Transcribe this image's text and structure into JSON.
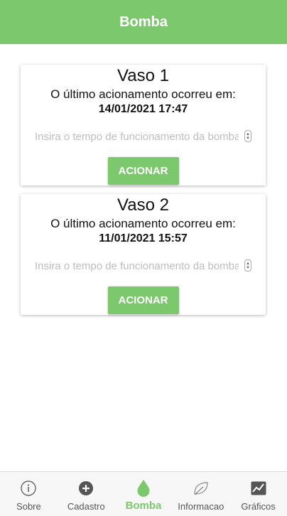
{
  "header": {
    "title": "Bomba"
  },
  "cards": [
    {
      "title": "Vaso 1",
      "message": "O último acionamento ocorreu em:",
      "datetime": "14/01/2021 17:47",
      "input_placeholder": "Insira o tempo de funcionamento da bomba",
      "button_label": "ACIONAR"
    },
    {
      "title": "Vaso 2",
      "message": "O último acionamento ocorreu em:",
      "datetime": "11/01/2021 15:57",
      "input_placeholder": "Insira o tempo de funcionamento da bomba",
      "button_label": "ACIONAR"
    }
  ],
  "tabbar": {
    "items": [
      {
        "label": "Sobre",
        "icon": "info-icon"
      },
      {
        "label": "Cadastro",
        "icon": "plus-circle-icon"
      },
      {
        "label": "Bomba",
        "icon": "water-drop-icon",
        "active": true
      },
      {
        "label": "Informacao",
        "icon": "leaf-icon"
      },
      {
        "label": "Gráficos",
        "icon": "chart-icon"
      }
    ]
  },
  "colors": {
    "accent": "#7cc86c",
    "inactive": "#555555"
  }
}
